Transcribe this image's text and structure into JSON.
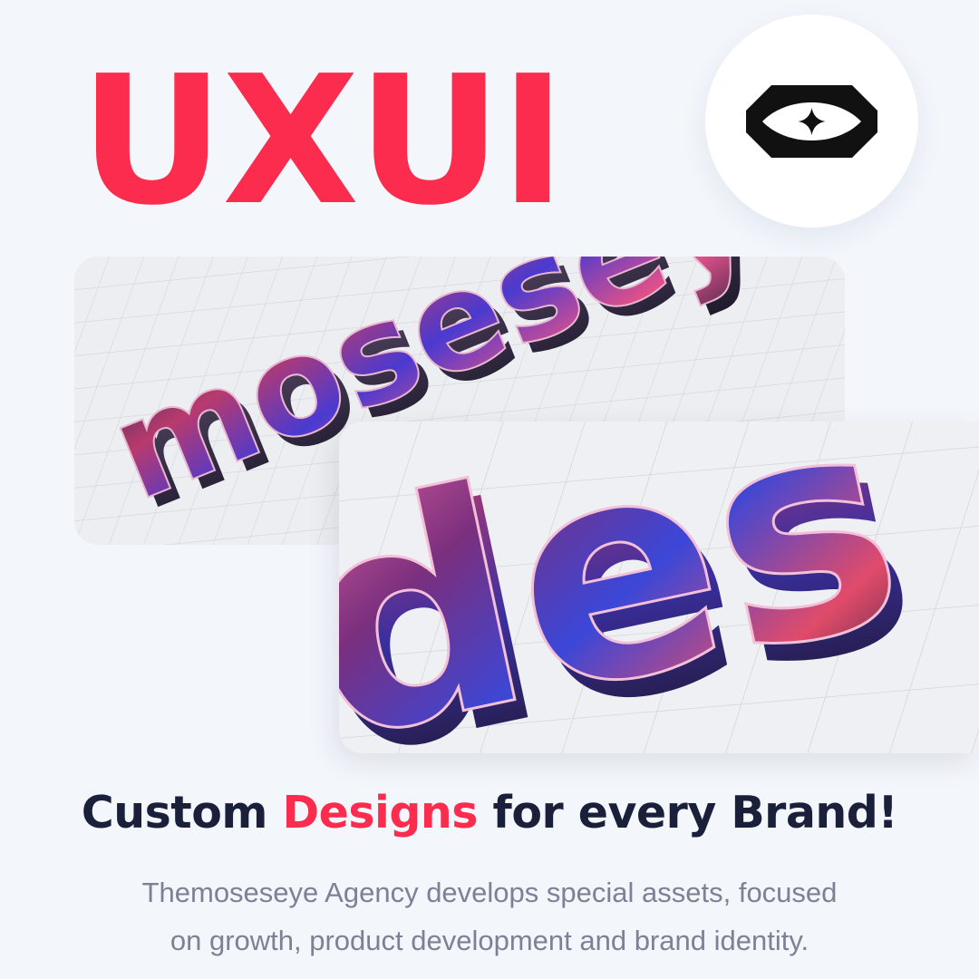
{
  "hero": {
    "title": "UXUI"
  },
  "logo": {
    "icon": "moseseye-logo-icon"
  },
  "cards": {
    "back_image_text": "moseseye",
    "front_image_text": "es"
  },
  "tagline": {
    "part1": "Custom ",
    "highlight": "Designs",
    "part2": " for every Brand!"
  },
  "description": {
    "line1": "Themoseseye Agency develops special assets, focused",
    "line2": "on growth, product development and brand identity."
  },
  "colors": {
    "accent": "#fb2c4d",
    "heading": "#1a1f3a",
    "body_text": "#7d8196",
    "background": "#f3f6fb"
  }
}
